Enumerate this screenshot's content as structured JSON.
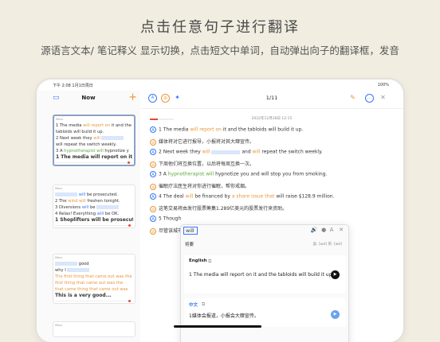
{
  "headline": "点击任意句子进行翻译",
  "subline": "源语言文本/ 笔记释义 显示切换，点击短文中单词，自动弹出向子的翻译框，发音",
  "status": {
    "time": "下午 2:08  1月1日周日",
    "battery": "100%"
  },
  "sidebar": {
    "title": "Now",
    "cards": [
      {
        "meta": "Meus",
        "lines": [
          "1 The media will report on it and the",
          "tabloids will build it up.",
          "2 Next week they will",
          "will repeat the switch weekly.",
          "3 A hypnotherapist will hypnotize y",
          "3 The media will report on it and t"
        ]
      },
      {
        "meta": "Meus",
        "lines": [
          "will be prosecuted.",
          "2 The wind will freshen tonight.",
          "3 Diversions will be",
          "4 Relax! Everything will be OK.",
          "1 Shoplifters will be prosecut..."
        ]
      },
      {
        "meta": "Meus",
        "lines": [
          "good",
          "why I",
          "The first thing that came out was the",
          "first thing that came out was the",
          "that came thing that came out was",
          "This is a very good..."
        ]
      },
      {
        "meta": "Meus",
        "lines": []
      }
    ]
  },
  "main": {
    "counter": "1/11",
    "date": "2022年12月28日 12:15",
    "lines": [
      {
        "mark": "A",
        "text": "1   The media will report on it and the tabloids will build it up."
      },
      {
        "mark": "B",
        "text": "媒体将对它进行报导，小报将对其大肆宣传。"
      },
      {
        "mark": "A",
        "text": "2   Next week they will                      and will repeat the switch weekly."
      },
      {
        "mark": "B",
        "text": "下周他们将互换位置，以后将每周互换一次。"
      },
      {
        "mark": "A",
        "text": "3   A hypnotherapist will hypnotize you and will stop you from smoking."
      },
      {
        "mark": "B",
        "text": "催眠疗法医生将对你进行催眠，帮你戒烟。"
      },
      {
        "mark": "A",
        "text": "4   The deal will be financed by a share issue that will raise $128.9 million."
      },
      {
        "mark": "B",
        "text": "这笔交易将由发行股票筹集1.289亿美元的股票发行来资助。"
      },
      {
        "mark": "A",
        "text": "5   Though"
      },
      {
        "mark": "B",
        "text": "尽管该城市"
      }
    ]
  },
  "popup": {
    "word": "will",
    "thesaurus": "将要",
    "phonetic": "美: [wɪl] 英: [wɪl]",
    "english_label": "English",
    "english_text": "1   The media will report on it and the tabloids will build it up.",
    "chinese_label": "中文",
    "chinese_text": "1媒体会报道，小报会大肆宣传。"
  }
}
